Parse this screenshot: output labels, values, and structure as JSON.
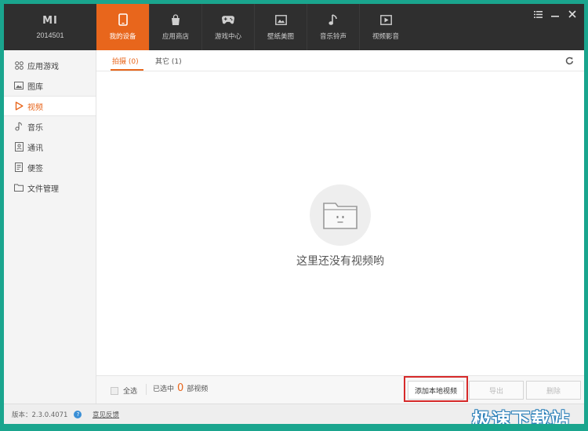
{
  "device": {
    "logo": "MI",
    "id": "2014501"
  },
  "tabs": [
    {
      "label": "我的设备",
      "icon": "phone-icon",
      "active": true
    },
    {
      "label": "应用商店",
      "icon": "shopping-bag-icon",
      "active": false
    },
    {
      "label": "游戏中心",
      "icon": "gamepad-icon",
      "active": false
    },
    {
      "label": "壁纸美图",
      "icon": "picture-icon",
      "active": false
    },
    {
      "label": "音乐铃声",
      "icon": "music-note-icon",
      "active": false
    },
    {
      "label": "视频影音",
      "icon": "video-play-icon",
      "active": false
    }
  ],
  "window_controls": [
    "menu-icon",
    "minimize-icon",
    "close-icon"
  ],
  "sidebar": {
    "items": [
      {
        "label": "应用游戏",
        "icon": "apps-grid-icon",
        "active": false
      },
      {
        "label": "图库",
        "icon": "image-icon",
        "active": false
      },
      {
        "label": "视频",
        "icon": "play-triangle-icon",
        "active": true
      },
      {
        "label": "音乐",
        "icon": "music-note-icon",
        "active": false
      },
      {
        "label": "通讯",
        "icon": "contacts-icon",
        "active": false
      },
      {
        "label": "便签",
        "icon": "note-icon",
        "active": false
      },
      {
        "label": "文件管理",
        "icon": "folder-icon",
        "active": false
      }
    ]
  },
  "subtabs": [
    {
      "label": "拍摄 (0)",
      "active": true
    },
    {
      "label": "其它 (1)",
      "active": false
    }
  ],
  "empty": {
    "message": "这里还没有视频哟",
    "icon": "sad-folder-icon"
  },
  "bottom": {
    "select_all": "全选",
    "selected_prefix": "已选中",
    "selected_count": "0",
    "selected_suffix": "部视频",
    "add_local": "添加本地视频",
    "export": "导出",
    "delete": "删除"
  },
  "status": {
    "version": "版本：2.3.0.4071",
    "feedback": "意见反馈",
    "watermark": "极速下载站"
  },
  "colors": {
    "accent": "#e8661c",
    "topbar": "#2f2f2f",
    "frame": "#1aa58e",
    "highlight": "#d62a2a"
  }
}
